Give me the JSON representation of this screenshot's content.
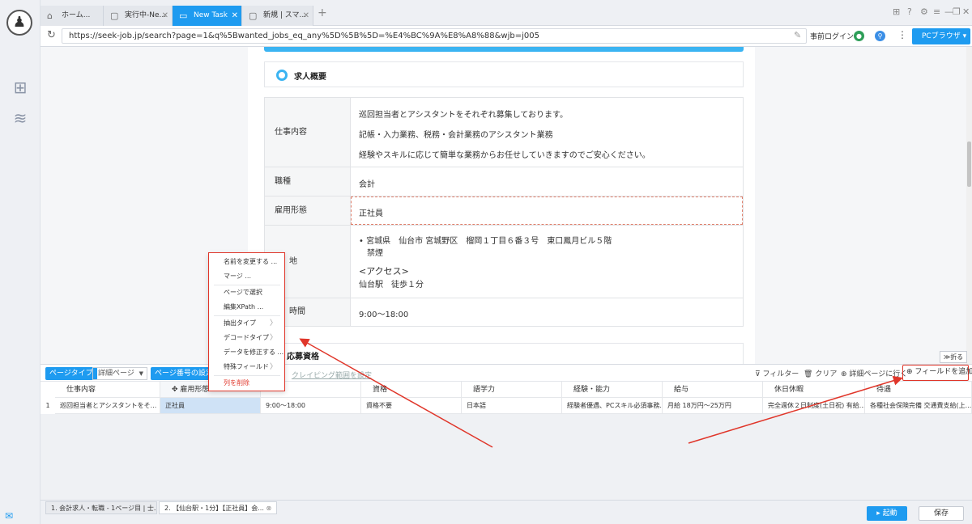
{
  "tabs": [
    {
      "label": "ホーム...",
      "icon": "home-icon"
    },
    {
      "label": "実行中-Ne...",
      "icon": "page-icon"
    },
    {
      "label": "New Task",
      "icon": "browser-icon"
    },
    {
      "label": "新規 | スマ...",
      "icon": "page-icon"
    }
  ],
  "address": {
    "url": "https://seek-job.jp/search?page=1&q%5Bwanted_jobs_eq_any%5D%5B%5D=%E4%BC%9A%E8%A8%88&wjb=j005",
    "prelogin": "事前ログイン",
    "browser_btn": "PCブラウザ"
  },
  "page": {
    "summary_title": "求人概要",
    "rows": [
      {
        "label": "仕事内容",
        "lines": [
          "巡回担当者とアシスタントをそれぞれ募集しております。",
          "記帳・入力業務、税務・会計業務のアシスタント業務",
          "経験やスキルに応じて簡単な業務からお任せしていきますのでご安心ください。"
        ]
      },
      {
        "label": "職種",
        "lines": [
          "会計"
        ]
      },
      {
        "label": "雇用形態",
        "lines": [
          "正社員"
        ]
      },
      {
        "label": "地",
        "lines": [
          "•  宮城県　仙台市 宮城野区　榴岡１丁目６番３号　東口鳳月ビル５階",
          "禁煙",
          "<アクセス>",
          "仙台駅　徒歩１分"
        ]
      },
      {
        "label": "時間",
        "lines": [
          "9:00〜18:00"
        ]
      }
    ],
    "qual_title": "応募資格"
  },
  "fold": "≫折る",
  "controls": {
    "page_type": "ページタイプ",
    "page_select": "詳細ページ",
    "page_num": "ページ番号の設定",
    "scrape_link": "クレイピング範囲を設定",
    "filter": "フィルター",
    "clear": "クリア",
    "goto": "詳細ページに行く",
    "add_field": "フィールドを追加"
  },
  "grid": {
    "headers": [
      "仕事内容",
      "雇用形態",
      "",
      "資格",
      "語学力",
      "経験・能力",
      "給与",
      "休日休暇",
      "待遇"
    ],
    "row": [
      "巡回担当者とアシスタントをそ...",
      "正社員",
      "9:00〜18:00",
      "資格不要",
      "日本語",
      "経験者優遇、PCスキル必須事務...",
      "月給 18万円〜25万円",
      "完全週休２日制度(土日祝) 有給...",
      "各種社会保険完備 交通費支給(上..."
    ],
    "row_num": "1"
  },
  "menu": [
    "名前を変更する ...",
    "マージ ...",
    "ページで選択",
    "編集XPath ...",
    "抽出タイプ",
    "デコードタイプ",
    "データを修正する ...",
    "特殊フィールド",
    "列を削除"
  ],
  "bottom_tabs": [
    "1. 会計求人・転職 - 1ページ目 | 士...",
    "2. 【仙台駅・1分】【正社員】会..."
  ],
  "run": "起動",
  "save": "保存",
  "colors": {
    "accent": "#1e9bf0",
    "highlight": "#e0362a"
  }
}
